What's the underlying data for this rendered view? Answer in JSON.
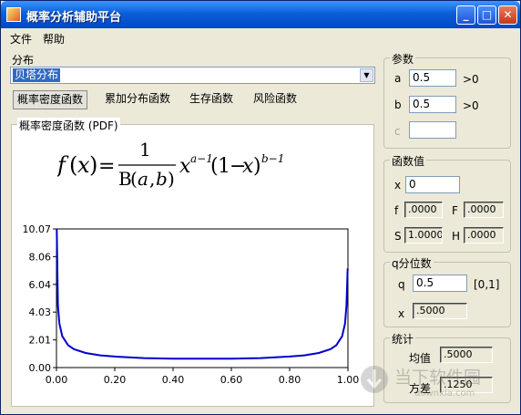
{
  "window": {
    "title": "概率分析辅助平台",
    "min_glyph": "_",
    "max_glyph": "□",
    "close_glyph": "✕"
  },
  "menu": {
    "file": "文件",
    "help": "帮助"
  },
  "distribution": {
    "label": "分布",
    "selected": "贝塔分布"
  },
  "tabs": [
    "概率密度函数",
    "累加分布函数",
    "生存函数",
    "风险函数"
  ],
  "plot": {
    "group_title": "概率密度函数 (PDF)",
    "formula": {
      "f": "f",
      "x": "x",
      "eq": "=",
      "num": "1",
      "B": "B",
      "a": "a",
      "b": "b",
      "exp_a": "a−1",
      "exp_b": "b−1",
      "one": "1",
      "minus": "−"
    }
  },
  "params": {
    "title": "参数",
    "a_label": "a",
    "a_value": "0.5",
    "a_hint": ">0",
    "b_label": "b",
    "b_value": "0.5",
    "b_hint": ">0",
    "c_label": "c",
    "c_value": ""
  },
  "function_values": {
    "title": "函数值",
    "x_label": "x",
    "x_value": "0",
    "f_label": "f",
    "f_value": ".0000",
    "F_label": "F",
    "F_value": ".0000",
    "S_label": "S",
    "S_value": "1.0000",
    "H_label": "H",
    "H_value": ".0000"
  },
  "quantile": {
    "title": "q分位数",
    "q_label": "q",
    "q_value": "0.5",
    "q_range": "[0,1]",
    "x_label": "x",
    "x_value": ".5000"
  },
  "stats": {
    "title": "统计",
    "mean_label": "均值",
    "mean_value": ".5000",
    "var_label": "方差",
    "var_value": ".1250"
  },
  "watermark": {
    "text": "当下软件园",
    "url": "downxia.com"
  },
  "chart_data": {
    "type": "line",
    "title": "",
    "xlabel": "",
    "ylabel": "",
    "xlim": [
      0,
      1
    ],
    "ylim": [
      0,
      10.07
    ],
    "xticks": [
      "0.00",
      "0.20",
      "0.40",
      "0.60",
      "0.80",
      "1.00"
    ],
    "yticks": [
      "0.00",
      "2.01",
      "4.03",
      "6.04",
      "8.06",
      "10.07"
    ],
    "grid": false,
    "series": [
      {
        "color": "#0000cc",
        "x": [
          0.001,
          0.005,
          0.01,
          0.02,
          0.04,
          0.06,
          0.1,
          0.15,
          0.2,
          0.3,
          0.4,
          0.5,
          0.6,
          0.7,
          0.8,
          0.85,
          0.9,
          0.94,
          0.96,
          0.98,
          0.99,
          0.995,
          0.999
        ],
        "y": [
          10.07,
          4.52,
          3.2,
          2.27,
          1.62,
          1.34,
          1.06,
          0.89,
          0.8,
          0.69,
          0.65,
          0.64,
          0.65,
          0.69,
          0.8,
          0.89,
          1.06,
          1.34,
          1.62,
          2.27,
          3.2,
          4.52,
          7.2
        ]
      }
    ]
  }
}
